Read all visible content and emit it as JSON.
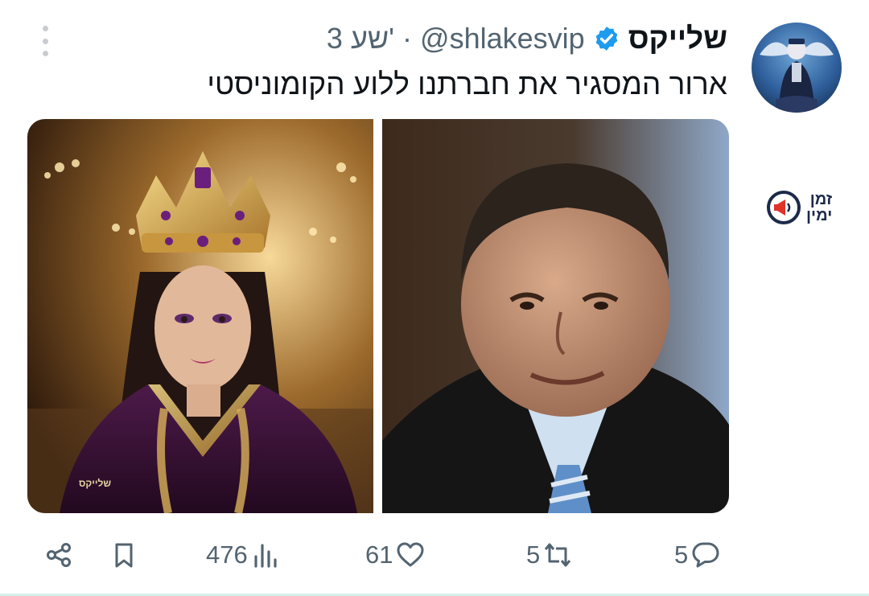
{
  "author": {
    "display_name": "שלייקס",
    "handle": "@shlakesvip",
    "time": "3 שע'",
    "separator": "·"
  },
  "tweet": {
    "text": "ארור המסגיר את חברתנו ללוע הקומוניסטי",
    "image_watermark": "שלייקס"
  },
  "side_logo": {
    "line1": "זמן",
    "line2": "ימין"
  },
  "actions": {
    "replies": "5",
    "retweets": "5",
    "likes": "61",
    "views": "476"
  },
  "colors": {
    "text_primary": "#0f1419",
    "text_secondary": "#536471",
    "verified_blue": "#1d9bf0"
  }
}
